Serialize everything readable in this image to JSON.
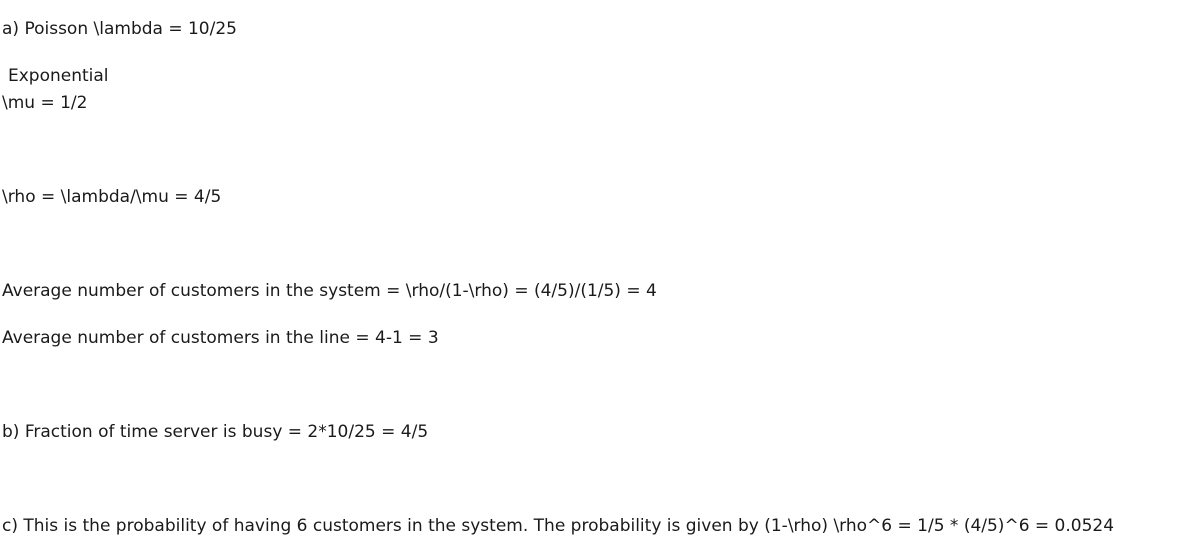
{
  "answer": {
    "part_a_poisson": "a) Poisson \\lambda = 10/25",
    "exponential": "Exponential",
    "mu": "\\mu = 1/2",
    "rho": "\\rho = \\lambda/\\mu = 4/5",
    "avg_system": "Average number of customers in the system = \\rho/(1-\\rho) = (4/5)/(1/5) = 4",
    "avg_line": "Average number of customers in the line = 4-1 = 3",
    "part_b": "b) Fraction of time server is busy = 2*10/25 = 4/5",
    "part_c": "c) This is the probability of having 6 customers in the system. The probability is given by (1-\\rho) \\rho^6 = 1/5 * (4/5)^6 = 0.0524"
  }
}
